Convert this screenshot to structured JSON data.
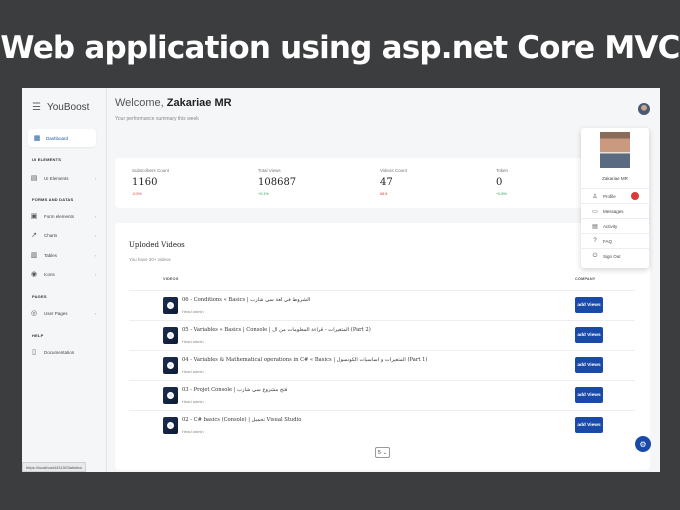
{
  "banner": {
    "title": "Web application using asp.net Core MVC"
  },
  "sidebar": {
    "brand": "YouBoost",
    "active_item": "Dashboard",
    "sections": {
      "ui": "UI ELEMENTS",
      "forms": "FORMS AND DATAS",
      "pages": "PAGES",
      "help": "HELP"
    },
    "items": {
      "ui_elements": "UI Elements",
      "form_elements": "Form elements",
      "charts": "Charts",
      "tables": "Tables",
      "icons": "Icons",
      "user_pages": "User Pages",
      "documentation": "Documentation"
    }
  },
  "header": {
    "welcome": "Welcome,",
    "user": "Zakariae MR",
    "subtitle": "Your performance summary this week"
  },
  "stats": [
    {
      "label": "Subscribers Count",
      "value": "1160",
      "change": "-0.5%",
      "direction": "down"
    },
    {
      "label": "Total Views",
      "value": "108687",
      "change": "+0.1%",
      "direction": "up"
    },
    {
      "label": "Videos Count",
      "value": "47",
      "change": "68.8",
      "direction": "down"
    },
    {
      "label": "Token",
      "value": "0",
      "change": "+0.8%",
      "direction": "up"
    }
  ],
  "videos": {
    "title": "Uploded Videos",
    "subtitle": "You have 20+ videos",
    "col_video": "VIDEOS",
    "col_company": "COMPANY",
    "button_label": "add Views",
    "rows": [
      {
        "title": "06 - Conditions « Basics | الشروط في لغة سي شارب",
        "author": "Head admin"
      },
      {
        "title": "05 - Variables « Basics | Console | المتغيرات - قراءة المعلومات من ال (Part 2)",
        "author": "Head admin"
      },
      {
        "title": "04 - Variables & Mathematical operations in C# « Basics | المتغيرات و اساسيات الكونسول (Part 1)",
        "author": "Head admin"
      },
      {
        "title": "03 - Projet Console | فتح مشروع سي شارب",
        "author": "Head admin"
      },
      {
        "title": "02 - C# basics (Console) | تحميل Visual Studio",
        "author": "Head admin"
      }
    ],
    "page_size": "5"
  },
  "dropdown": {
    "name": "Zakariae MR",
    "items": [
      "Profile",
      "Messages",
      "Activity",
      "FAQ",
      "Sign Out"
    ]
  },
  "status_url": "https://localhost44315/Statistics",
  "colors": {
    "accent": "#1a4aa8",
    "negative": "#d93a3a",
    "positive": "#2e9a4f"
  }
}
